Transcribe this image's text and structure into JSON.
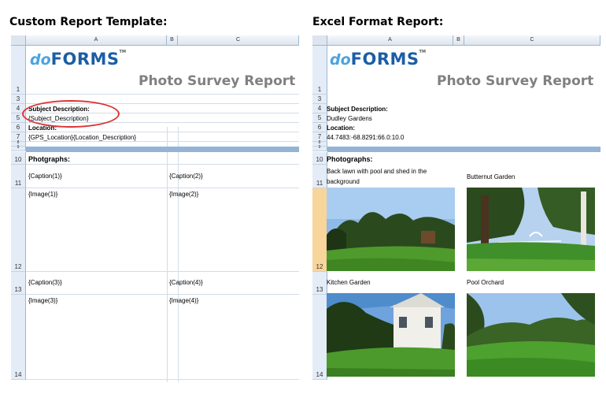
{
  "left_heading": "Custom Report Template:",
  "right_heading": "Excel Format Report:",
  "columns": [
    "A",
    "B",
    "C"
  ],
  "logo": {
    "do": "do",
    "forms": "FORMS",
    "tm": "TM"
  },
  "report_title": "Photo Survey Report",
  "rows": [
    "1",
    "3",
    "4",
    "5",
    "6",
    "7",
    "8",
    "9",
    "10",
    "11",
    "12",
    "13",
    "14"
  ],
  "template": {
    "subject_label": "Subject Description:",
    "subject_value": "{Subject_Description}",
    "location_label": "Location:",
    "location_value": "{GPS_Location}{Location_Description}",
    "photographs_label": "Photgraphs:",
    "caption1": "{Caption(1)}",
    "caption2": "{Caption(2)}",
    "image1": "{Image(1)}",
    "image2": "{Image(2)}",
    "caption3": "{Caption(3)}",
    "caption4": "{Caption(4)}",
    "image3": "{Image(3)}",
    "image4": "{Image(4)}"
  },
  "report": {
    "subject_label": "Subject Description:",
    "subject_value": "Dudley Gardens",
    "location_label": "Location:",
    "location_value": "44.7483:-68.8291:66.0:10.0",
    "photographs_label": "Photographs:",
    "caption1_line1": "Back lawn with pool and shed in the",
    "caption1_line2": "background",
    "caption2": "Butternut Garden",
    "caption3": "Kitchen Garden",
    "caption4": "Pool Orchard"
  },
  "colors": {
    "header_blue": "#95b3d7",
    "logo_light": "#4aa3df",
    "logo_dark": "#1b5ea6",
    "title_gray": "#808080",
    "highlight_oval": "#dd3333"
  }
}
